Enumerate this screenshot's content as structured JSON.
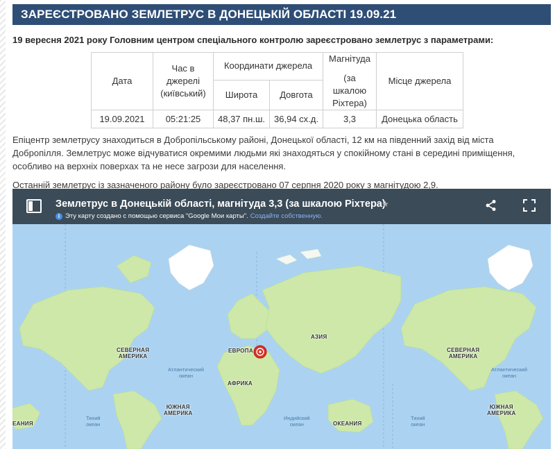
{
  "article": {
    "headline": "ЗАРЕЄСТРОВАНО ЗЕМЛЕТРУС В ДОНЕЦЬКІЙ ОБЛАСТІ 19.09.21",
    "lead": "19 вересня 2021 року Головним центром спеціального контролю зареєстровано землетрус з параметрами:",
    "table": {
      "date_header": "Дата",
      "time_header_l1": "Час в",
      "time_header_l2": "джерелі",
      "time_header_l3": "(київський)",
      "coords_header": "Координати джерела",
      "lat_header": "Широта",
      "lon_header": "Довгота",
      "mag_header_l1": "Магнітуда",
      "mag_header_l2": "(за шкалою",
      "mag_header_l3": "Ріхтера)",
      "place_header": "Місце джерела",
      "row": {
        "date": "19.09.2021",
        "time": "05:21:25",
        "lat": "48,37 пн.ш.",
        "lon": "36,94 сх.д.",
        "mag": "3,3",
        "place": "Донецька область"
      }
    },
    "paragraph1_l1": "Епіцентр землетрусу знаходиться в Добропільському районі, Донецької області, 12 км на південний захід від міста",
    "paragraph1_l2": "Добропілля. Землетрус може відчуватися окремими людьми які знаходяться у спокійному стані в середині приміщення,",
    "paragraph1_l3": "особливо на верхніх поверхах та не несе загрози для населення.",
    "paragraph2": "Останній землетрус із зазначеного району було зареєстровано 07 серпня 2020 року з магнітудою 2,9."
  },
  "map": {
    "title": "Землетрус в Донецькій області, магнітуда 3,3 (за шкалою Ріхтера)",
    "notice": "Эту карту создано с помощью сервиса \"Google Мои карты\".",
    "notice_link": "Создайте собственную.",
    "icons": [
      "layers-panel-icon",
      "star-icon",
      "share-icon",
      "fullscreen-icon",
      "info-icon",
      "marker-icon"
    ],
    "labels": {
      "na_l1": "СЕВЕРНАЯ",
      "na_l2": "АМЕРИКА",
      "na2_l1": "СЕВЕРНАЯ",
      "na2_l2": "АМЕРИКА",
      "europe": "ЕВРОПА",
      "asia": "АЗИЯ",
      "africa": "АФРИКА",
      "sa_l1": "ЮЖНАЯ",
      "sa_l2": "АМЕРИКА",
      "sa2_l1": "ЮЖНАЯ",
      "sa2_l2": "АМЕРИКА",
      "oceania_left": "ЕАНИЯ",
      "oceania": "ОКЕАНИЯ",
      "atlantic_l1": "Атлантический",
      "atlantic_l2": "океан",
      "atlantic2_l1": "Атлантический",
      "atlantic2_l2": "океан",
      "pacific_l1": "Тихий",
      "pacific_l2": "океан",
      "pacific2_l1": "Тихий",
      "pacific2_l2": "океан",
      "indian_l1": "Индийский",
      "indian_l2": "океан"
    },
    "colors": {
      "header": "#3b4b57",
      "water": "#abd3f1",
      "land": "#cde8a8",
      "ice": "#ffffff",
      "marker": "#d93025"
    }
  }
}
